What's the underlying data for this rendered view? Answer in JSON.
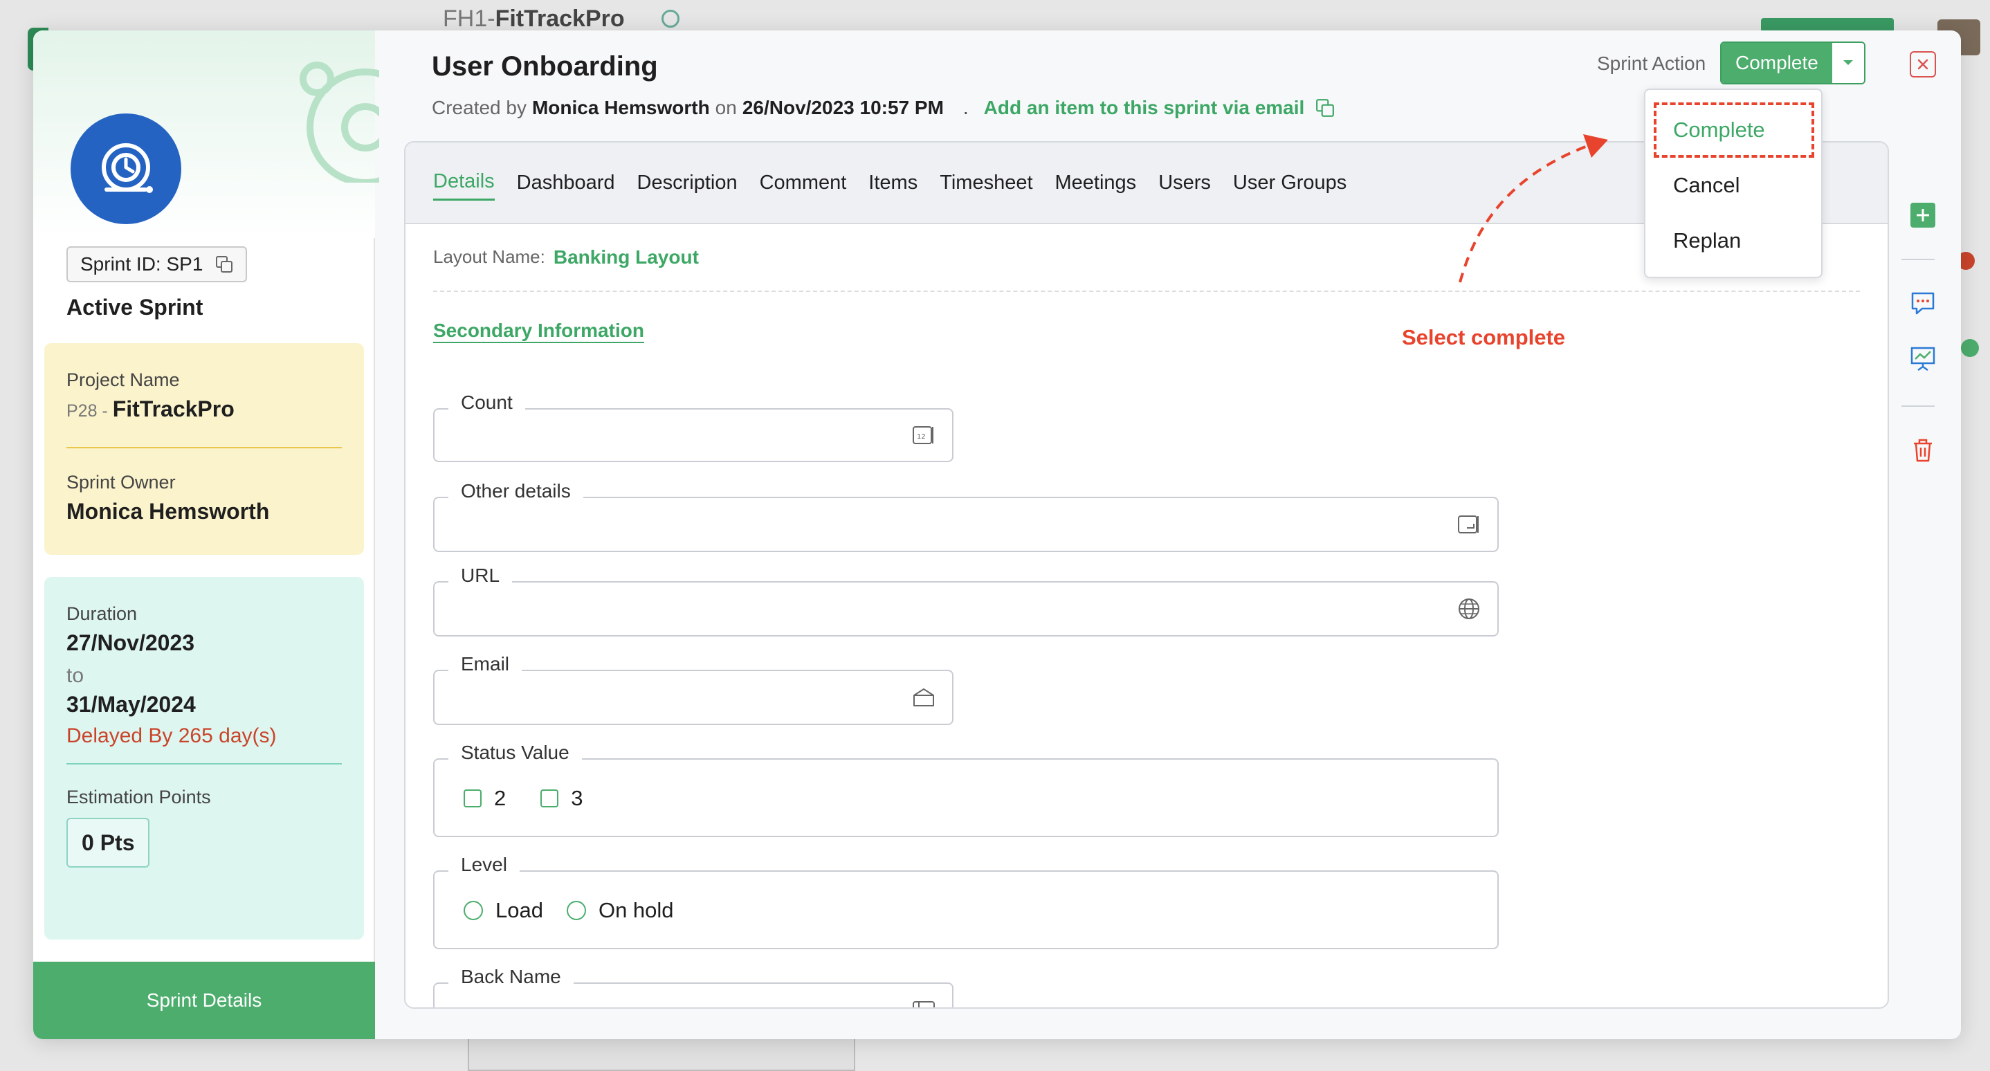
{
  "background": {
    "title_prefix": "FH1-",
    "title_project": "FitTrackPro"
  },
  "sprint": {
    "id_label": "Sprint ID: SP1",
    "status": "Active Sprint",
    "project_label": "Project Name",
    "project_code": "P28 - ",
    "project_name": "FitTrackPro",
    "owner_label": "Sprint Owner",
    "owner_name": "Monica Hemsworth",
    "duration_label": "Duration",
    "start_date": "27/Nov/2023",
    "to_word": "to",
    "end_date": "31/May/2024",
    "delayed": "Delayed By 265 day(s)",
    "estimation_label": "Estimation Points",
    "estimation_value": "0 Pts",
    "details_button": "Sprint Details"
  },
  "header": {
    "title": "User Onboarding",
    "created_by_prefix": "Created by",
    "created_by_name": "Monica Hemsworth",
    "on_word": "on",
    "created_date": "26/Nov/2023 10:57 PM",
    "separator": ".",
    "add_item_link": "Add an item to this sprint via email",
    "sprint_action_label": "Sprint Action",
    "sprint_action_button": "Complete"
  },
  "tabs": [
    {
      "label": "Details",
      "active": true
    },
    {
      "label": "Dashboard"
    },
    {
      "label": "Description"
    },
    {
      "label": "Comment"
    },
    {
      "label": "Items"
    },
    {
      "label": "Timesheet"
    },
    {
      "label": "Meetings"
    },
    {
      "label": "Users"
    },
    {
      "label": "User Groups"
    }
  ],
  "details": {
    "layout_label": "Layout Name:",
    "layout_value": "Banking Layout",
    "section_title": "Secondary Information",
    "fields": {
      "count": {
        "label": "Count",
        "icon": "number-icon"
      },
      "other_details": {
        "label": "Other details",
        "icon": "multiline-icon"
      },
      "url": {
        "label": "URL",
        "icon": "globe-icon"
      },
      "email": {
        "label": "Email",
        "icon": "email-icon"
      },
      "status_value": {
        "label": "Status Value",
        "options": [
          "2",
          "3"
        ]
      },
      "level": {
        "label": "Level",
        "options": [
          "Load",
          "On hold"
        ]
      },
      "back_name": {
        "label": "Back Name",
        "icon": "text-field-icon"
      }
    }
  },
  "dropdown": {
    "items": [
      "Complete",
      "Cancel",
      "Replan"
    ],
    "selected": "Complete"
  },
  "annotation": {
    "text": "Select complete",
    "color": "#e8432c"
  },
  "colors": {
    "accent": "#4cad6d",
    "link": "#3da765",
    "danger": "#d9534f",
    "logo": "#2563c2",
    "yellow_card": "#fbf3cc",
    "teal_card": "#def6f0"
  }
}
